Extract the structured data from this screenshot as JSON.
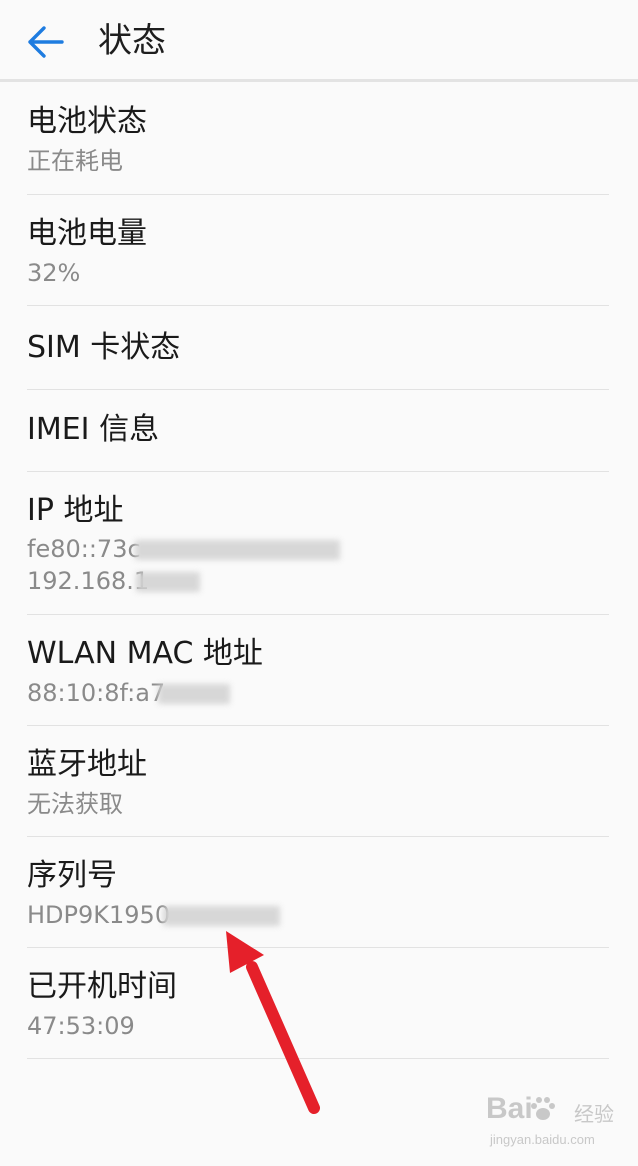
{
  "header": {
    "title": "状态"
  },
  "items": [
    {
      "title": "电池状态",
      "subtitle": "正在耗电"
    },
    {
      "title": "电池电量",
      "subtitle": "32%"
    },
    {
      "title": "SIM 卡状态"
    },
    {
      "title": "IMEI 信息"
    },
    {
      "title": "IP 地址",
      "subtitle": "fe80::73c",
      "subtitle2": "192.168.1"
    },
    {
      "title": "WLAN MAC 地址",
      "subtitle": "88:10:8f:a7"
    },
    {
      "title": "蓝牙地址",
      "subtitle": "无法获取"
    },
    {
      "title": "序列号",
      "subtitle": "HDP9K1950"
    },
    {
      "title": "已开机时间",
      "subtitle": "47:53:09"
    }
  ],
  "watermark": {
    "logo": "Bai",
    "cn": "经验",
    "url": "jingyan.baidu.com"
  },
  "colors": {
    "accent": "#1e7ce0",
    "annotation_arrow": "#e5202a",
    "divider": "#e2e2e2"
  }
}
